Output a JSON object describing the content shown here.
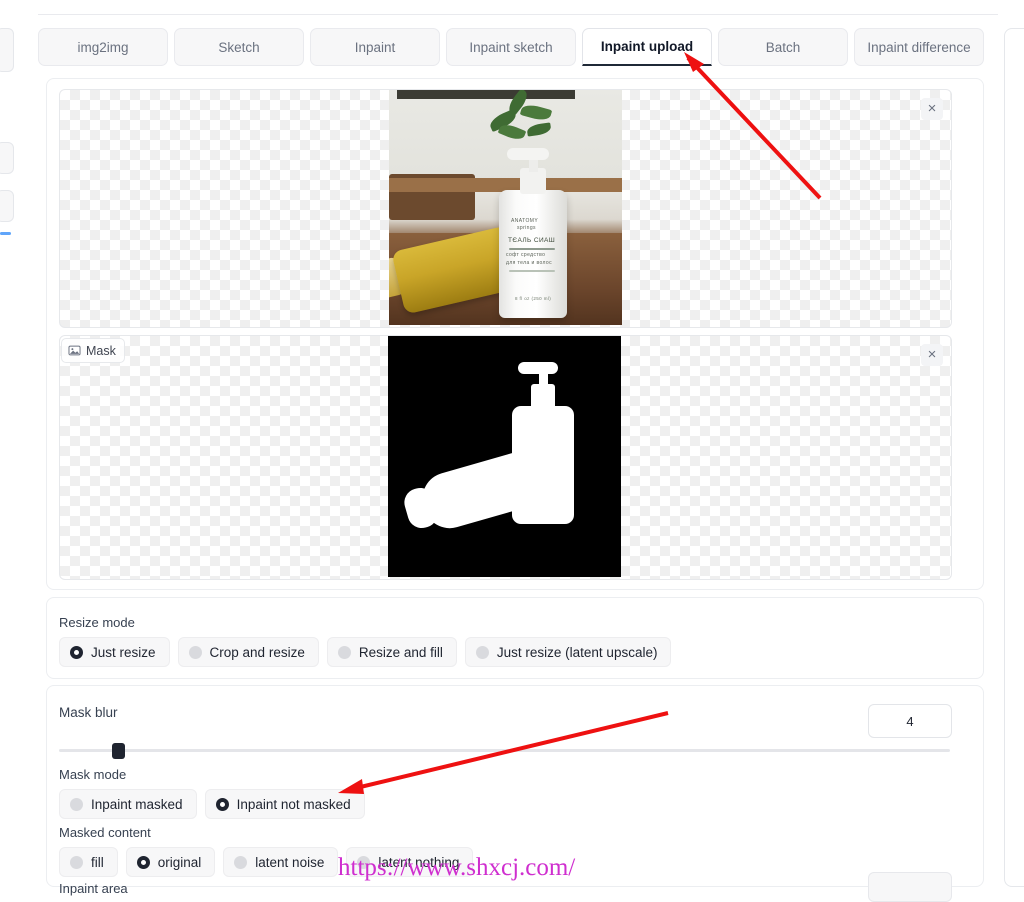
{
  "tabs": [
    {
      "label": "img2img",
      "active": false
    },
    {
      "label": "Sketch",
      "active": false
    },
    {
      "label": "Inpaint",
      "active": false
    },
    {
      "label": "Inpaint sketch",
      "active": false
    },
    {
      "label": "Inpaint upload",
      "active": true
    },
    {
      "label": "Batch",
      "active": false
    },
    {
      "label": "Inpaint difference",
      "active": false
    }
  ],
  "source_image": {
    "close_label": "×",
    "product_label_line1": "ANATOMY",
    "product_label_line2": "springs",
    "product_label_line3": "ТЄАЛЬ СИАШ",
    "product_label_line4": "софт средство",
    "product_label_line5": "для тела и волос",
    "product_label_line6": "8 fl oz (250 ml)"
  },
  "mask_image": {
    "tag_label": "Mask",
    "tag_icon": "image-icon",
    "close_label": "×"
  },
  "resize_mode": {
    "label": "Resize mode",
    "options": [
      {
        "label": "Just resize",
        "selected": true
      },
      {
        "label": "Crop and resize",
        "selected": false
      },
      {
        "label": "Resize and fill",
        "selected": false
      },
      {
        "label": "Just resize (latent upscale)",
        "selected": false
      }
    ]
  },
  "mask_blur": {
    "label": "Mask blur",
    "value": "4",
    "min": 0,
    "max": 64,
    "thumb_percent": 6
  },
  "mask_mode": {
    "label": "Mask mode",
    "options": [
      {
        "label": "Inpaint masked",
        "selected": false
      },
      {
        "label": "Inpaint not masked",
        "selected": true
      }
    ]
  },
  "masked_content": {
    "label": "Masked content",
    "options": [
      {
        "label": "fill",
        "selected": false
      },
      {
        "label": "original",
        "selected": true
      },
      {
        "label": "latent noise",
        "selected": false
      },
      {
        "label": "latent nothing",
        "selected": false
      }
    ]
  },
  "inpaint_area": {
    "label": "Inpaint area"
  },
  "watermark": {
    "text": "https://www.shxcj.com/"
  },
  "annotations": {
    "arrow1_target": "Inpaint upload tab",
    "arrow2_target": "Inpaint not masked option",
    "arrow_color": "#ee1111"
  }
}
